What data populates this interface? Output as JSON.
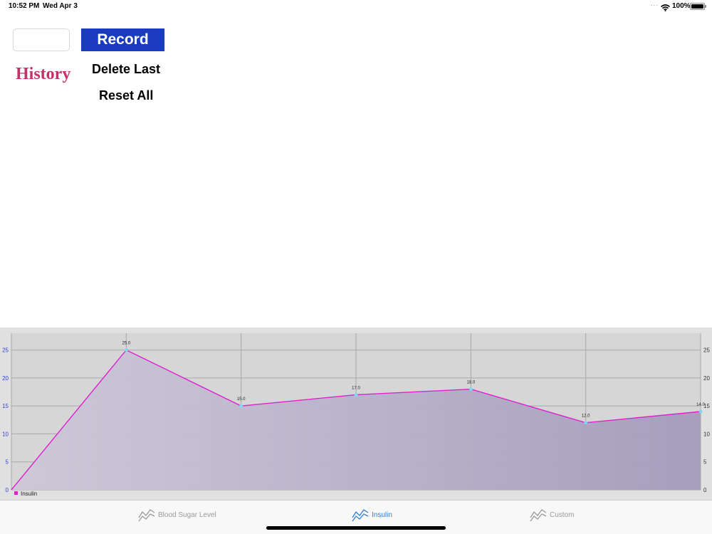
{
  "status_bar": {
    "time": "10:52 PM",
    "date": "Wed Apr 3",
    "battery": "100%"
  },
  "entry": {
    "value": "",
    "record_label": "Record",
    "history_label": "History",
    "delete_label": "Delete Last",
    "reset_label": "Reset All"
  },
  "colors": {
    "record_button": "#1a3bbf",
    "history": "#c4306a",
    "series_line": "#e020d0",
    "point": "#7fd8f0",
    "tab_active": "#2f7fd5"
  },
  "chart_data": {
    "type": "area",
    "series": [
      {
        "name": "Insulin",
        "values": [
          0,
          25.0,
          15.0,
          17.0,
          18.0,
          12.0,
          14.0
        ],
        "labels": [
          "",
          "25.0",
          "15.0",
          "17.0",
          "18.0",
          "12.0",
          "14.0"
        ]
      }
    ],
    "ylim": [
      0,
      28
    ],
    "yticks": [
      "0",
      "5",
      "10",
      "15",
      "20",
      "25"
    ],
    "grid": true,
    "legend_position": "bottom-left"
  },
  "tabs": [
    {
      "label": "Blood Sugar Level",
      "icon": "line-chart-icon",
      "active": false
    },
    {
      "label": "Insulin",
      "icon": "line-chart-icon",
      "active": true
    },
    {
      "label": "Custom",
      "icon": "line-chart-icon",
      "active": false
    }
  ]
}
